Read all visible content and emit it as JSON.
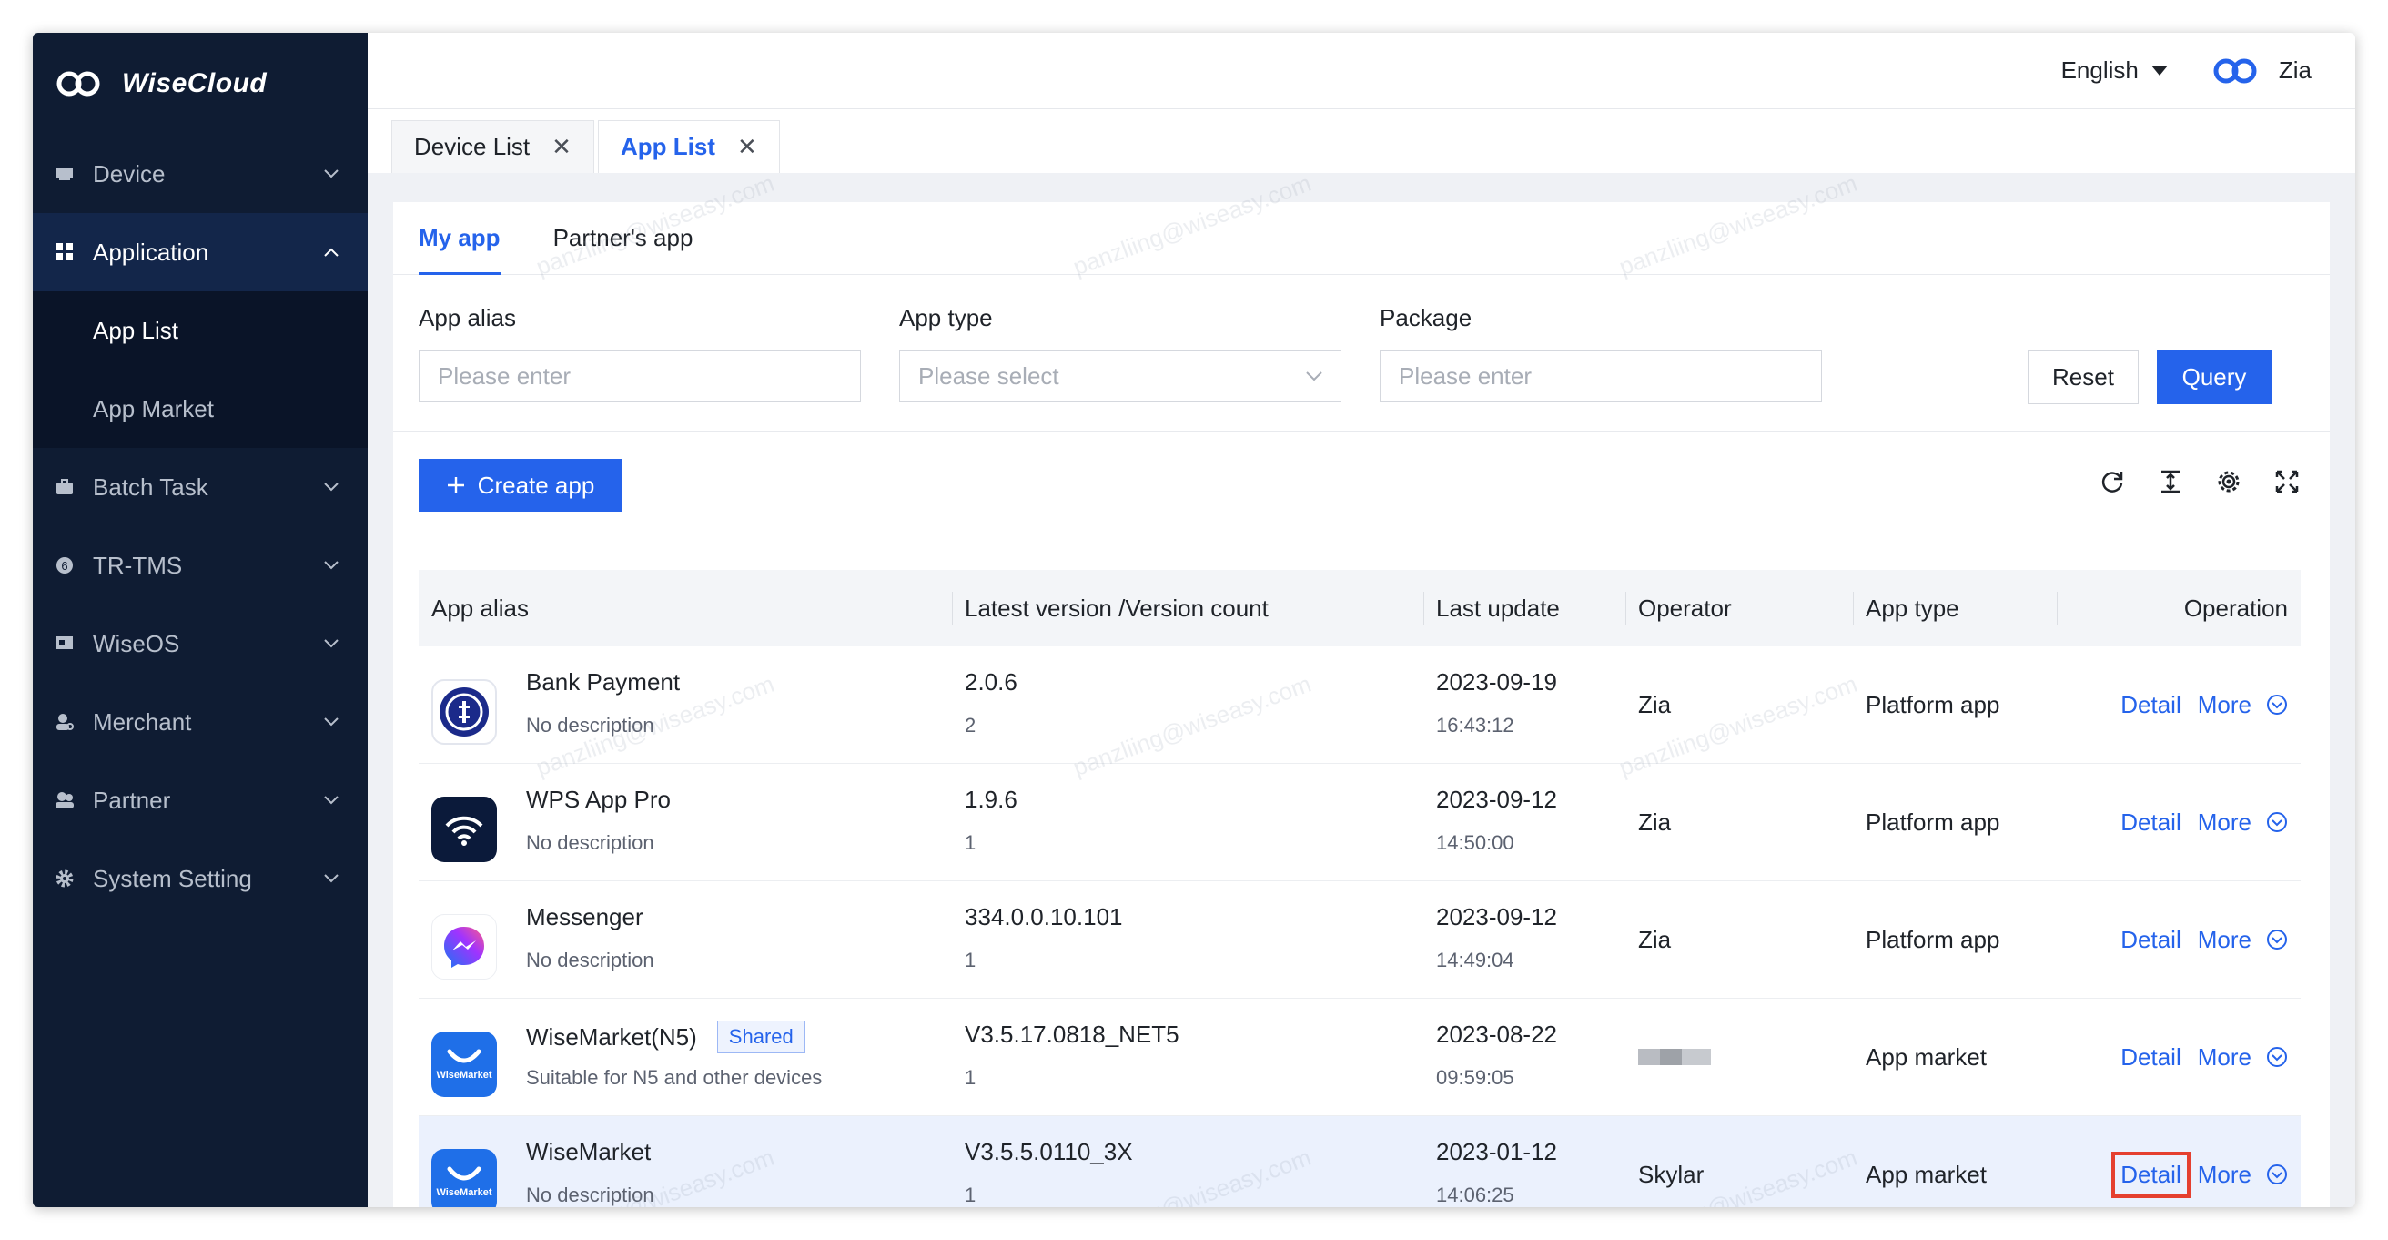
{
  "brand": {
    "name": "WiseCloud"
  },
  "sidebar": {
    "items": [
      {
        "label": "Device",
        "icon": "device-icon"
      },
      {
        "label": "Application",
        "icon": "grid-icon",
        "expanded": true,
        "children": [
          {
            "label": "App List",
            "current": true
          },
          {
            "label": "App Market"
          }
        ]
      },
      {
        "label": "Batch Task",
        "icon": "briefcase-icon"
      },
      {
        "label": "TR-TMS",
        "icon": "circle-number-icon"
      },
      {
        "label": "WiseOS",
        "icon": "os-icon"
      },
      {
        "label": "Merchant",
        "icon": "merchant-icon"
      },
      {
        "label": "Partner",
        "icon": "partner-icon"
      },
      {
        "label": "System Setting",
        "icon": "gear-icon"
      }
    ]
  },
  "topbar": {
    "language": "English",
    "user": "Zia"
  },
  "tabs": [
    {
      "label": "Device List"
    },
    {
      "label": "App List",
      "active": true
    }
  ],
  "subtabs": [
    {
      "label": "My app",
      "active": true
    },
    {
      "label": "Partner's app"
    }
  ],
  "filters": {
    "app_alias": {
      "label": "App alias",
      "placeholder": "Please enter"
    },
    "app_type": {
      "label": "App type",
      "placeholder": "Please select"
    },
    "package": {
      "label": "Package",
      "placeholder": "Please enter"
    },
    "reset": "Reset",
    "query": "Query"
  },
  "toolbar": {
    "create": "Create app"
  },
  "table": {
    "headers": [
      "App alias",
      "Latest version /Version count",
      "Last update",
      "Operator",
      "App type",
      "Operation"
    ],
    "rows": [
      {
        "icon": "bank-payment-icon",
        "name": "Bank Payment",
        "badge": "",
        "desc": "No description",
        "version": "2.0.6",
        "count": "2",
        "date": "2023-09-19",
        "time": "16:43:12",
        "operator": "Zia",
        "type": "Platform app"
      },
      {
        "icon": "wps-wifi-icon",
        "name": "WPS App Pro",
        "badge": "",
        "desc": "No description",
        "version": "1.9.6",
        "count": "1",
        "date": "2023-09-12",
        "time": "14:50:00",
        "operator": "Zia",
        "type": "Platform app"
      },
      {
        "icon": "messenger-icon",
        "name": "Messenger",
        "badge": "",
        "desc": "No description",
        "version": "334.0.0.10.101",
        "count": "1",
        "date": "2023-09-12",
        "time": "14:49:04",
        "operator": "Zia",
        "type": "Platform app"
      },
      {
        "icon": "wisemarket-icon",
        "name": "WiseMarket(N5)",
        "badge": "Shared",
        "desc": "Suitable for N5 and other devices",
        "version": "V3.5.17.0818_NET5",
        "count": "1",
        "date": "2023-08-22",
        "time": "09:59:05",
        "operator": "",
        "type": "App market"
      },
      {
        "icon": "wisemarket-icon",
        "name": "WiseMarket",
        "badge": "",
        "desc": "No description",
        "version": "V3.5.5.0110_3X",
        "count": "1",
        "date": "2023-01-12",
        "time": "14:06:25",
        "operator": "Skylar",
        "type": "App market"
      }
    ],
    "detail_label": "Detail",
    "more_label": "More"
  },
  "app_icon_text": "WiseMarket",
  "watermark": "panzliing@wiseasy.com",
  "colors": {
    "accent": "#2563eb",
    "sidebar": "#0f1c33",
    "highlight_border": "#e5402f"
  }
}
